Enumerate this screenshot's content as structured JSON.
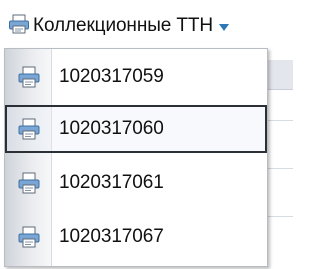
{
  "menu": {
    "title": "Коллекционные ТТН",
    "icon": "printer-icon",
    "dropdown_icon": "chevron-down-icon",
    "accent_color": "#2b78b9"
  },
  "items": [
    {
      "label": "1020317059",
      "icon": "printer-icon",
      "selected": false
    },
    {
      "label": "1020317060",
      "icon": "printer-icon",
      "selected": true
    },
    {
      "label": "1020317061",
      "icon": "printer-icon",
      "selected": false
    },
    {
      "label": "1020317067",
      "icon": "printer-icon",
      "selected": false
    }
  ]
}
